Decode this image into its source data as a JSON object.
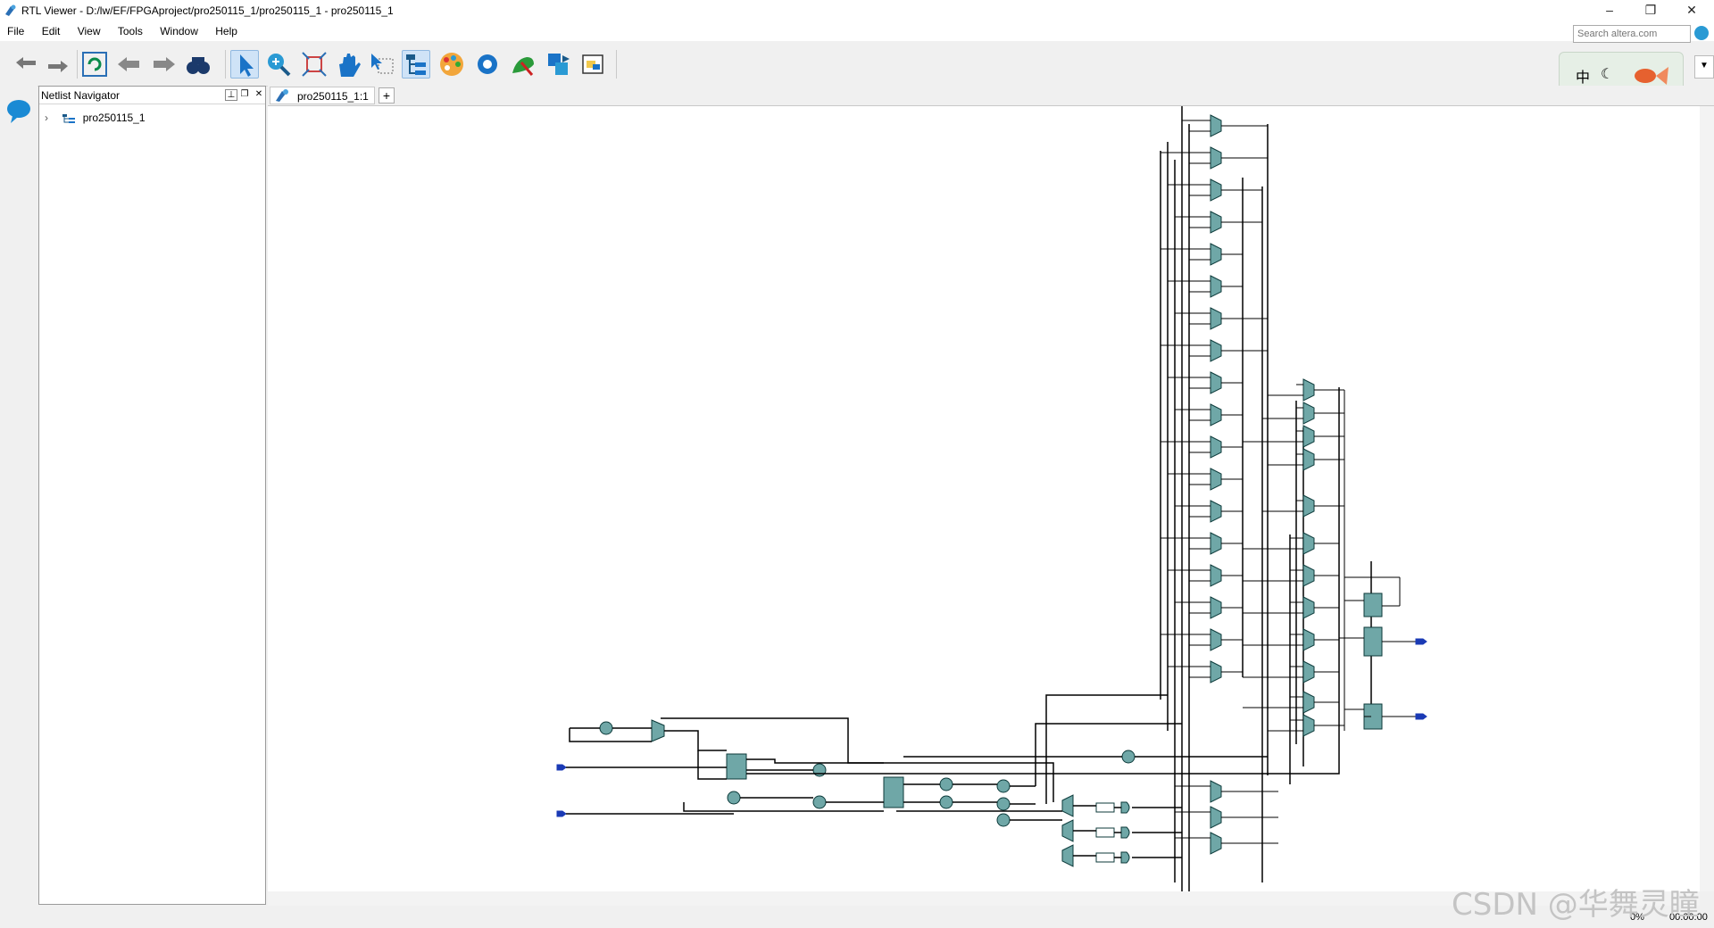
{
  "window": {
    "title": "RTL Viewer - D:/lw/EF/FPGAproject/pro250115_1/pro250115_1 - pro250115_1",
    "minimize": "–",
    "restore": "❐",
    "close": "✕"
  },
  "menu": [
    "File",
    "Edit",
    "View",
    "Tools",
    "Window",
    "Help"
  ],
  "search": {
    "placeholder": "Search altera.com"
  },
  "toolbar_icons": [
    "back-icon",
    "forward-icon",
    "refresh-icon",
    "previous-icon",
    "next-icon",
    "find-icon",
    "select-icon",
    "zoom-icon",
    "fit-icon",
    "hand-icon",
    "area-select-icon",
    "hierarchy-icon",
    "color-icon",
    "settings-icon",
    "bird-icon",
    "export-icon",
    "netlist-icon"
  ],
  "ime": {
    "lang": "中",
    "moon": "☾"
  },
  "navigator": {
    "title": "Netlist Navigator",
    "tree": [
      {
        "label": "pro250115_1",
        "expand": "›"
      }
    ]
  },
  "tabs": [
    {
      "label": "pro250115_1:1"
    }
  ],
  "tab_add": "+",
  "status": {
    "progress": "0%",
    "time": "00:00:00"
  },
  "watermark": "CSDN @华舞灵瞳"
}
